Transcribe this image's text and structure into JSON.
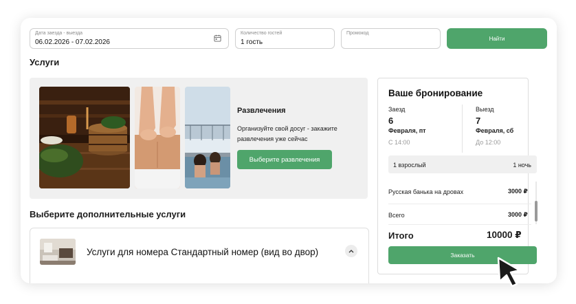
{
  "search": {
    "dates_label": "Дата заезда - выезда",
    "dates_value": "06.02.2026 - 07.02.2026",
    "guests_label": "Количество гостей",
    "guests_value": "1 гость",
    "promo_label": "Промокод",
    "promo_value": "",
    "find_button": "Найти"
  },
  "services": {
    "heading": "Услуги",
    "promo_title": "Развлечения",
    "promo_desc": "Организуйте свой досуг - закажите развлечения уже сейчас",
    "promo_button": "Выберите развлечения"
  },
  "extras": {
    "heading": "Выберите дополнительные услуги",
    "room_title": "Услуги для номера Стандартный номер (вид во двор)"
  },
  "booking": {
    "title": "Ваше бронирование",
    "checkin_label": "Заезд",
    "checkin_day": "6",
    "checkin_month": "Февраля, пт",
    "checkin_time": "С 14:00",
    "checkout_label": "Выезд",
    "checkout_day": "7",
    "checkout_month": "Февраля, сб",
    "checkout_time": "До 12:00",
    "guests": "1 взрослый",
    "nights": "1 ночь",
    "service_name": "Русская банька на дровах",
    "service_price": "3000 ₽",
    "subtotal_label": "Всего",
    "subtotal_price": "3000 ₽",
    "total_label": "Итого",
    "total_price": "10000 ₽",
    "order_button": "Заказать"
  },
  "colors": {
    "accent": "#4fa56b",
    "panel_bg": "#f0f0f0"
  }
}
